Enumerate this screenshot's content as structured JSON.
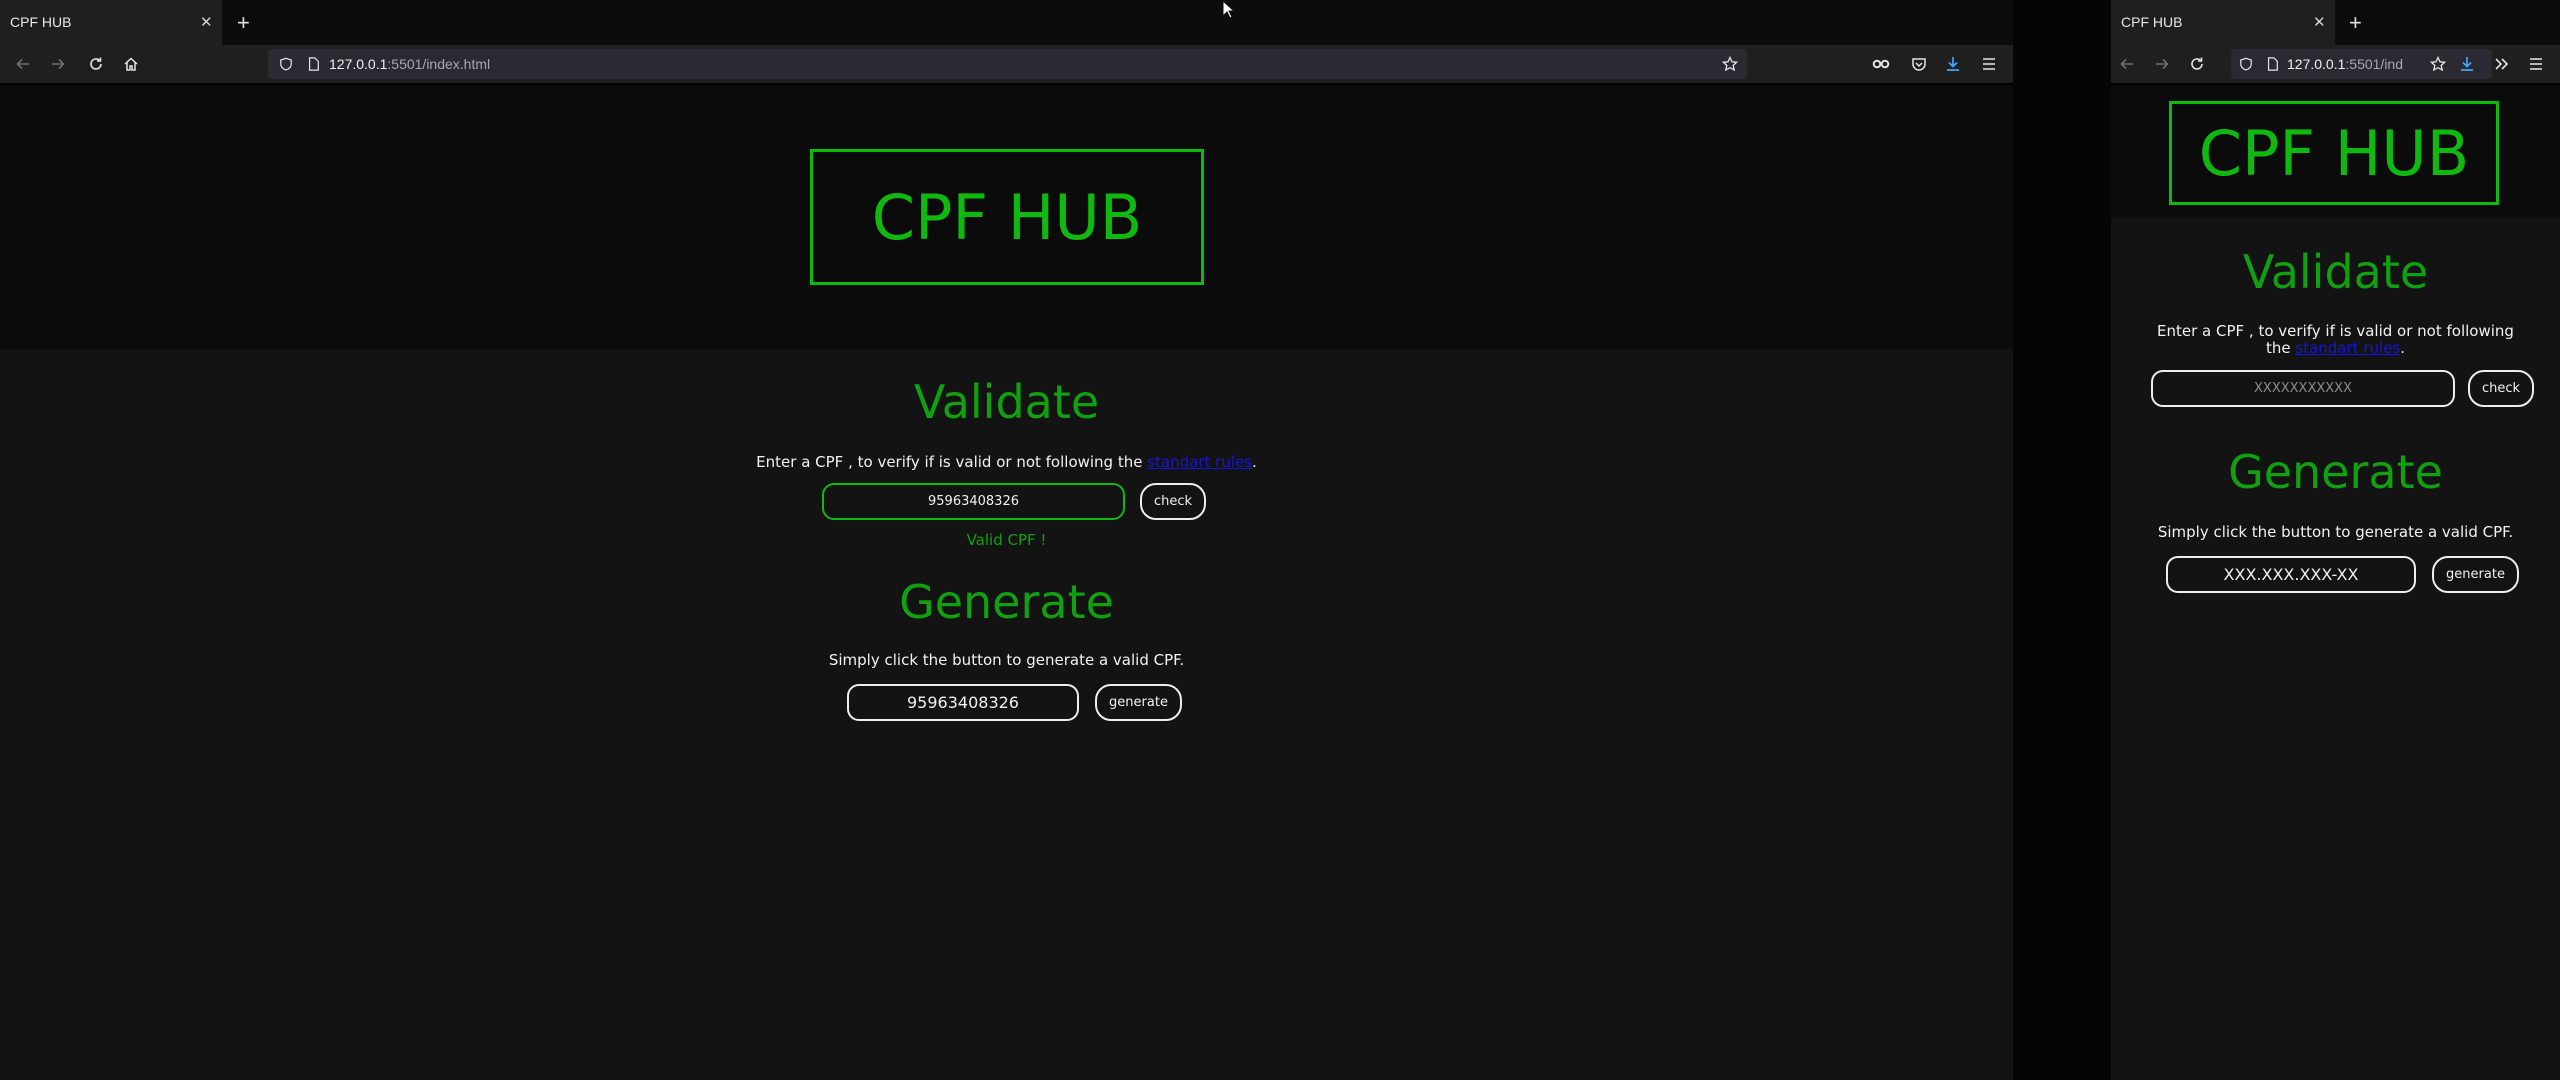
{
  "browser_left": {
    "tab_title": "CPF HUB",
    "url_host": "127.0.0.1",
    "url_path": ":5501/index.html"
  },
  "browser_right": {
    "tab_title": "CPF HUB",
    "url_host": "127.0.0.1",
    "url_path": ":5501/ind"
  },
  "page_left": {
    "logo": "CPF HUB",
    "validate": {
      "title": "Validate",
      "desc_prefix": "Enter a CPF , to verify if is valid or not following the ",
      "link": "standart rules",
      "desc_suffix": ".",
      "input_value": "95963408326",
      "button": "check",
      "result": "Valid CPF !"
    },
    "generate": {
      "title": "Generate",
      "desc": "Simply click the button to generate a valid CPF.",
      "output_value": "95963408326",
      "button": "generate"
    }
  },
  "page_right": {
    "logo": "CPF HUB",
    "validate": {
      "title": "Validate",
      "desc_prefix": "Enter a CPF , to verify if is valid or not following the ",
      "link": "standart rules",
      "desc_suffix": ".",
      "input_placeholder": "XXXXXXXXXXX",
      "button": "check"
    },
    "generate": {
      "title": "Generate",
      "desc": "Simply click the button to generate a valid CPF.",
      "output_value": "XXX.XXX.XXX-XX",
      "button": "generate"
    }
  },
  "colors": {
    "accent_green": "#10b910",
    "link_blue": "#1515d6",
    "downloads_blue": "#3fa6ff"
  },
  "icons": [
    "back-arrow-icon",
    "forward-arrow-icon",
    "reload-icon",
    "home-icon",
    "shield-icon",
    "page-icon",
    "star-icon",
    "mask-icon",
    "pocket-icon",
    "download-icon",
    "menu-icon",
    "overflow-chevron-icon",
    "close-icon",
    "plus-icon",
    "cursor-icon"
  ]
}
